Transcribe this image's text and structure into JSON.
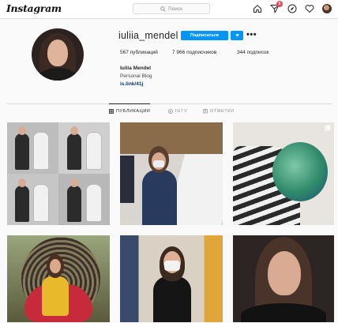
{
  "nav": {
    "logo": "Instagram",
    "search_placeholder": "Поиск",
    "notifications_badge": "6",
    "icons": [
      "home-icon",
      "direct-icon",
      "explore-icon",
      "heart-icon",
      "profile-avatar"
    ]
  },
  "profile": {
    "username": "iuliia_mendel",
    "follow_label": "Подписаться",
    "more_label": "•••",
    "stats": {
      "posts": "567 публикаций",
      "followers": "7 966 подписчиков",
      "following": "344 подписок"
    },
    "full_name": "Iuliia Mendel",
    "category": "Personal Blog",
    "link": "is.link/41j"
  },
  "tabs": [
    {
      "label": "ПУБЛИКАЦИИ",
      "icon": "grid-icon",
      "active": true
    },
    {
      "label": "IGTV",
      "icon": "igtv-icon",
      "active": false
    },
    {
      "label": "ОТМЕТКИ",
      "icon": "tag-icon",
      "active": false
    }
  ],
  "posts": [
    {
      "subject": "woman-with-robots-collage"
    },
    {
      "subject": "meeting-with-masks"
    },
    {
      "subject": "green-hair-striped-shirt"
    },
    {
      "subject": "woman-in-hanging-chair"
    },
    {
      "subject": "woman-in-mask-hallway"
    },
    {
      "subject": "portrait-smiling"
    }
  ],
  "colors": {
    "accent": "#0095f6",
    "badge": "#ed4956",
    "link": "#00376b"
  }
}
